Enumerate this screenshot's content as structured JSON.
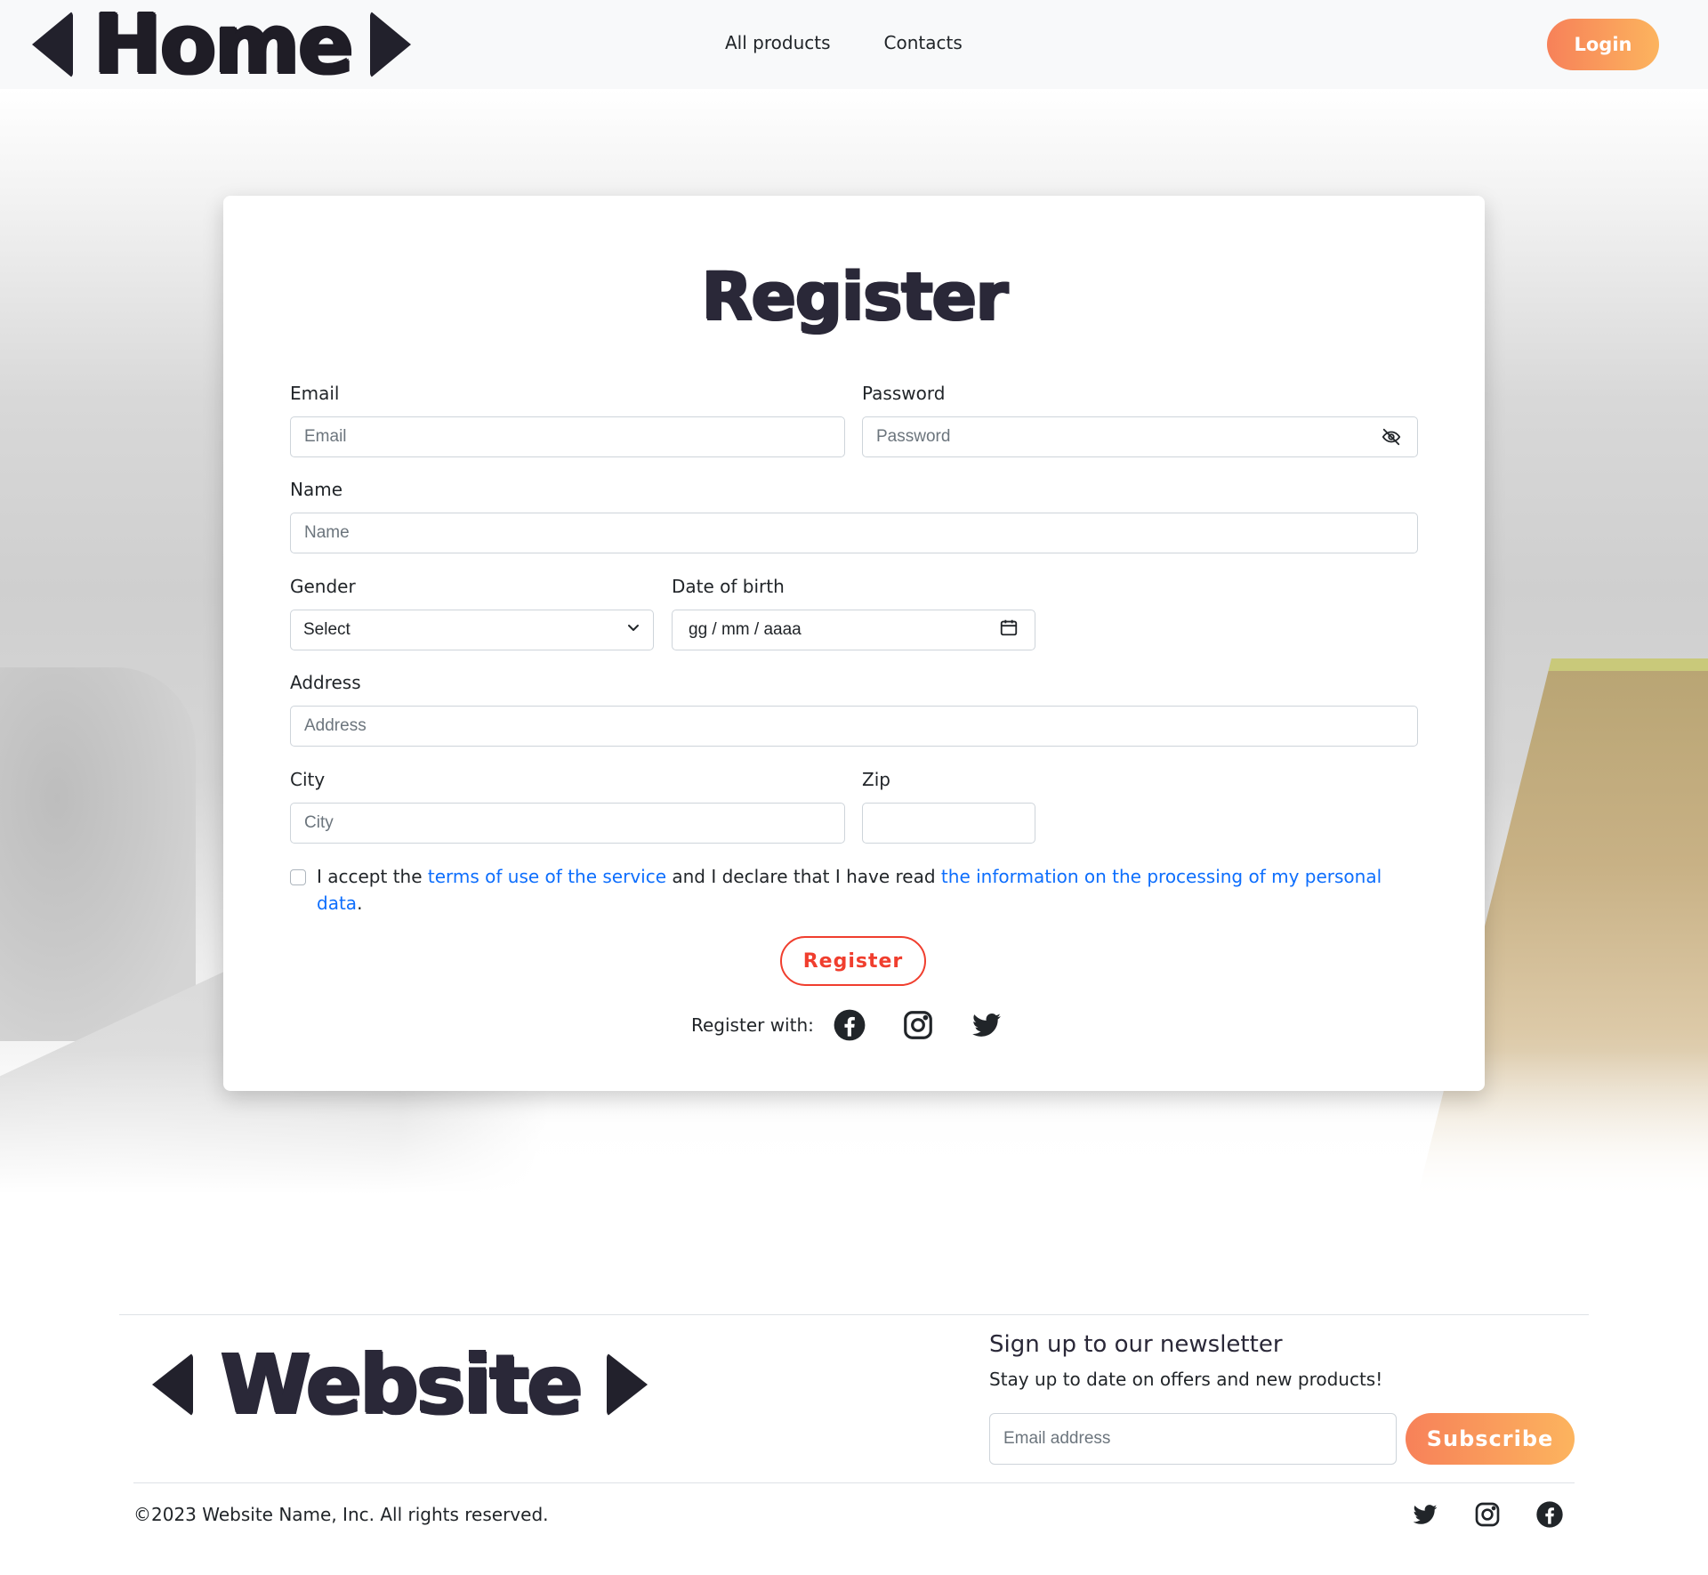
{
  "navbar": {
    "brand": "Home",
    "links": [
      "All products",
      "Contacts"
    ],
    "login_label": "Login"
  },
  "form": {
    "title": "Register",
    "email": {
      "label": "Email",
      "placeholder": "Email"
    },
    "password": {
      "label": "Password",
      "placeholder": "Password",
      "toggle_icon": "eye-slash-icon"
    },
    "name": {
      "label": "Name",
      "placeholder": "Name"
    },
    "gender": {
      "label": "Gender",
      "selected": "Select",
      "icon": "chevron-down-icon"
    },
    "dob": {
      "label": "Date of birth",
      "placeholder": "gg / mm / aaaa",
      "icon": "calendar-icon"
    },
    "address": {
      "label": "Address",
      "placeholder": "Address"
    },
    "city": {
      "label": "City",
      "placeholder": "City"
    },
    "zip": {
      "label": "Zip",
      "placeholder": ""
    },
    "terms": {
      "part1": "I accept the ",
      "link1": "terms of use of the service",
      "part2": " and I declare that I have read ",
      "link2": "the information on the processing of my personal data",
      "part3": "."
    },
    "register_label": "Register",
    "register_with_label": "Register with:",
    "socials": [
      "facebook-icon",
      "instagram-icon",
      "twitter-icon"
    ]
  },
  "footer": {
    "brand": "Website",
    "newsletter_title": "Sign up to our newsletter",
    "newsletter_sub": "Stay up to date on offers and new products!",
    "newsletter_placeholder": "Email address",
    "subscribe_label": "Subscribe",
    "copyright": "©2023 Website Name, Inc. All rights reserved.",
    "socials": [
      "twitter-icon",
      "instagram-icon",
      "facebook-icon"
    ]
  },
  "colors": {
    "accent_gradient_start": "#f78159",
    "accent_gradient_end": "#fcb45e",
    "register_red": "#f03e2e",
    "link_blue": "#0d6efd",
    "brand_dark": "#2a2838"
  }
}
